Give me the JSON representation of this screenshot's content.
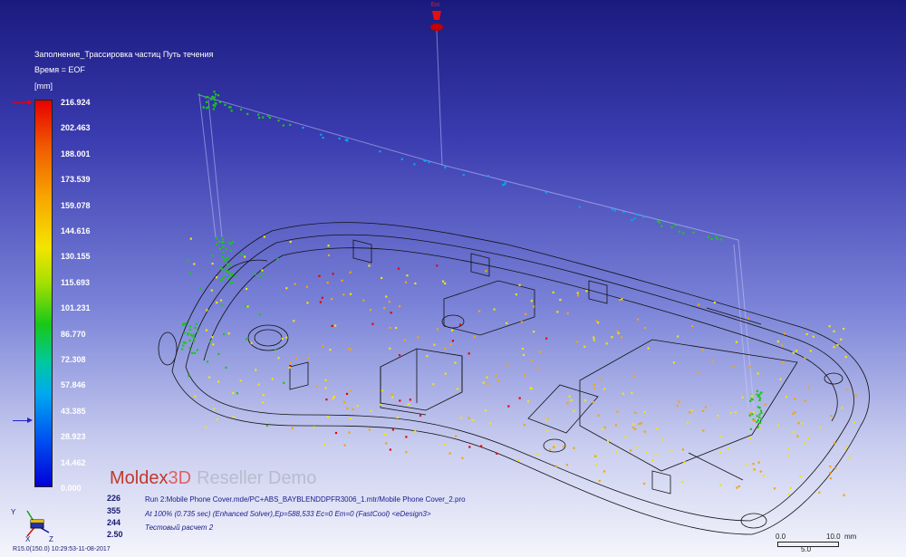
{
  "legend": {
    "result_title": "Заполнение_Трассировка частиц Путь течения",
    "time_label": "Время = EOF",
    "unit": "[mm]",
    "ticks": [
      "216.924",
      "202.463",
      "188.001",
      "173.539",
      "159.078",
      "144.616",
      "130.155",
      "115.693",
      "101.231",
      "86.770",
      "72.308",
      "57.846",
      "43.385",
      "28.923",
      "14.462",
      "0.000"
    ]
  },
  "brand": {
    "name": "Moldex",
    "name_3d": "3D",
    "subtitle": "Reseller Demo"
  },
  "stats": [
    "226",
    "355",
    "244",
    "2.50"
  ],
  "info": {
    "run": "Run 2:Mobile Phone Cover.mde/PC+ABS_BAYBLENDDPFR3006_1.mtr/Mobile Phone Cover_2.pro",
    "solver": "At 100% (0.735 sec) (Enhanced Solver),Ep=588,533 Ec=0 Em=0 (FastCool) <eDesign3>",
    "run_name": "Тестовый расчет 2"
  },
  "version": "R15.0(150.0) 10:29:53-11-08-2017",
  "scale": {
    "left": "0.0",
    "right": "10.0",
    "unit_prefix": "mm",
    "mid": "5.0"
  },
  "axes": {
    "x": "X",
    "y": "Y",
    "z": "Z"
  },
  "colors": {
    "max": "#e80000",
    "high": "#f7a500",
    "mid": "#f4e400",
    "low_mid": "#18c818",
    "low": "#00a8f0",
    "min": "#0000d8"
  }
}
